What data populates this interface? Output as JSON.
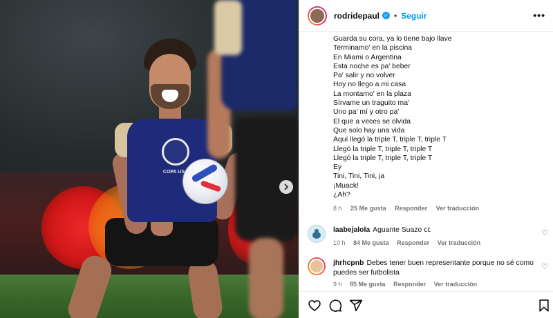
{
  "media": {
    "next_icon": "chevron-right-icon",
    "crest_text": "COPA USA"
  },
  "header": {
    "username": "rodridepaul",
    "verified_icon": "verified-badge-icon",
    "separator": "•",
    "follow_label": "Seguir",
    "more_icon": "more-options-icon",
    "more_glyph": "•••"
  },
  "caption": {
    "lines": [
      "Guarda su cora, ya lo tiene bajo llave",
      "Terminamo' en la piscina",
      "En Miami o Argentina",
      "Esta noche es pa' beber",
      "Pa' salir y no volver",
      "Hoy no llego a mi casa",
      "La montamo' en la plaza",
      "Sírvame un traguito ma'",
      "Uno pa' mí y otro pa'",
      "El que a veces se olvida",
      "Que solo hay una vida",
      "Aquí llegó la triple T, triple T, triple T",
      "Llegó la triple T, triple T, triple T",
      "Llegó la triple T, triple T, triple T",
      "Ey",
      "Tini, Tini, Tini, ja",
      "¡Muack!",
      "¿Ah?"
    ],
    "time": "8 h",
    "likes": "25 Me gusta",
    "reply": "Responder",
    "translate": "Ver traducción"
  },
  "comments": [
    {
      "username": "laabejalola",
      "text": "Aguante Suazo ㏄",
      "time": "10 h",
      "likes": "84 Me gusta",
      "reply": "Responder",
      "translate": "Ver traducción",
      "avatar_color": "#b9d7e6"
    },
    {
      "username": "jhrhcpnb",
      "text": "Debes tener buen representante porque no sé como puedes ser futbolista",
      "time": "9 h",
      "likes": "85 Me gusta",
      "reply": "Responder",
      "translate": "Ver traducción",
      "avatar_color": "#e9c29a"
    }
  ],
  "footer": {
    "like_icon": "heart-icon",
    "comment_icon": "comment-icon",
    "share_icon": "share-icon",
    "save_icon": "bookmark-icon"
  },
  "colors": {
    "link_blue": "#0095f6",
    "muted": "#737373"
  }
}
